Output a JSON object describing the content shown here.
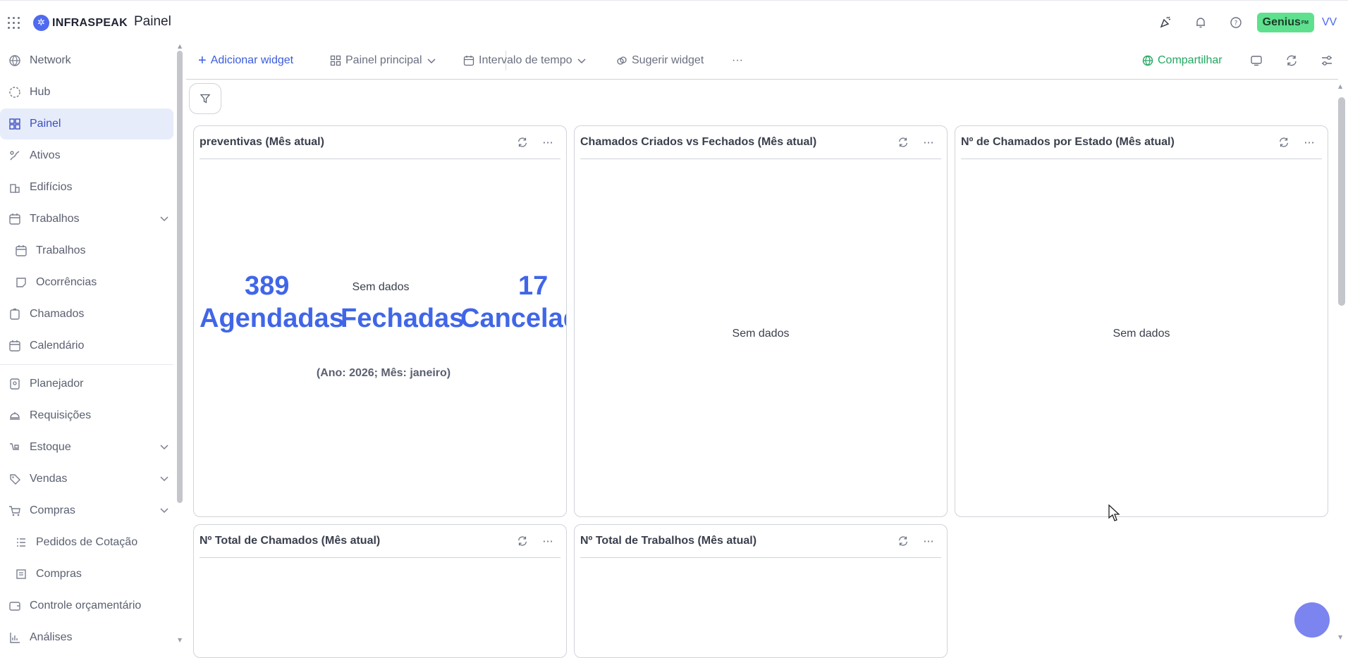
{
  "app": {
    "brand": "INFRASPEAK",
    "page_title": "Painel",
    "genius_label": "Genius",
    "genius_sup": "FM",
    "avatar_initials": "VV"
  },
  "sidebar": {
    "items": [
      {
        "label": "Network",
        "icon": "globe-icon"
      },
      {
        "label": "Hub",
        "icon": "hub-icon"
      },
      {
        "label": "Painel",
        "icon": "dashboard-icon",
        "active": true
      },
      {
        "label": "Ativos",
        "icon": "assets-icon"
      },
      {
        "label": "Edifícios",
        "icon": "building-icon"
      },
      {
        "label": "Trabalhos",
        "icon": "calendar-icon",
        "expandable": true
      },
      {
        "label": "Trabalhos",
        "icon": "calendar-icon",
        "sub": true
      },
      {
        "label": "Ocorrências",
        "icon": "note-icon",
        "sub": true
      },
      {
        "label": "Chamados",
        "icon": "clipboard-icon"
      },
      {
        "label": "Calendário",
        "icon": "calendar-icon"
      },
      {
        "label": "Planejador",
        "icon": "planner-icon"
      },
      {
        "label": "Requisições",
        "icon": "bell-service-icon"
      },
      {
        "label": "Estoque",
        "icon": "stock-icon",
        "expandable": true
      },
      {
        "label": "Vendas",
        "icon": "tag-icon",
        "expandable": true
      },
      {
        "label": "Compras",
        "icon": "cart-icon",
        "expandable": true
      },
      {
        "label": "Pedidos de Cotação",
        "icon": "list-icon",
        "sub": true
      },
      {
        "label": "Compras",
        "icon": "receipt-icon",
        "sub": true
      },
      {
        "label": "Controle orçamentário",
        "icon": "wallet-icon"
      },
      {
        "label": "Análises",
        "icon": "chart-icon"
      }
    ]
  },
  "toolbar": {
    "add_widget": "Adicionar widget",
    "dashboard_select": "Painel principal",
    "time_range": "Intervalo de tempo",
    "suggest_widget": "Sugerir widget",
    "more": "···",
    "share": "Compartilhar"
  },
  "widgets": {
    "preventivas": {
      "title": "preventivas (Mês atual)",
      "scheduled_value": "389",
      "scheduled_label": "Agendadas",
      "closed_value": "Sem dados",
      "closed_label": "Fechadas",
      "cancelled_value": "17",
      "cancelled_label": "Cancelad",
      "period": "(Ano: 2026; Mês: janeiro)"
    },
    "created_vs_closed": {
      "title": "Chamados Criados vs Fechados (Mês atual)",
      "empty": "Sem dados"
    },
    "by_state": {
      "title": "Nº de Chamados por Estado (Mês atual)",
      "empty": "Sem dados"
    },
    "total_calls": {
      "title": "Nº Total de Chamados (Mês atual)"
    },
    "total_jobs": {
      "title": "Nº Total de Trabalhos (Mês atual)"
    }
  },
  "colors": {
    "accent": "#4066e8",
    "share_green": "#22a860",
    "genius_green": "#5ee08e",
    "active_bg": "#e7ecfb"
  }
}
